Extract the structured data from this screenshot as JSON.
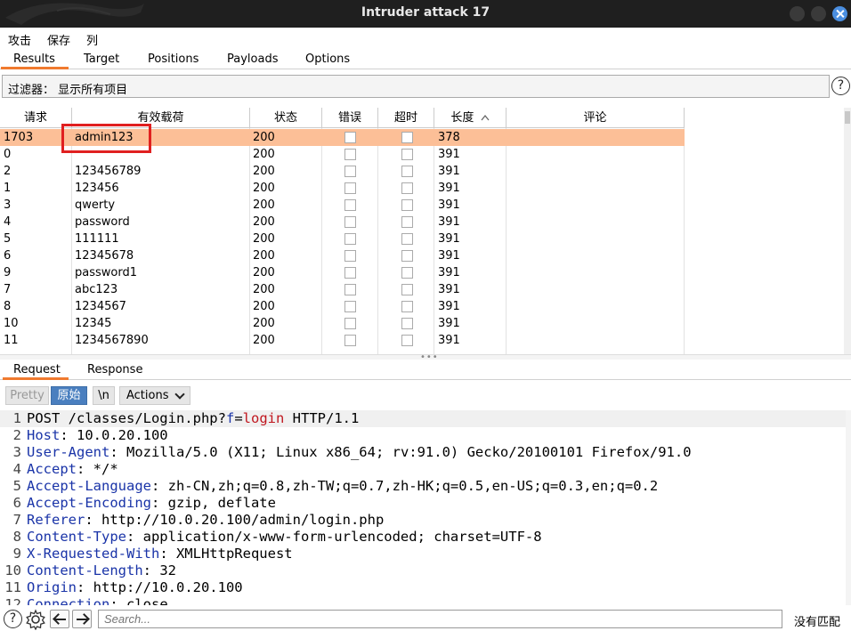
{
  "window": {
    "title": "Intruder attack 17"
  },
  "menu": [
    "攻击",
    "保存",
    "列"
  ],
  "tabs": [
    "Results",
    "Target",
    "Positions",
    "Payloads",
    "Options"
  ],
  "filter": {
    "label": "过滤器： 显示所有项目",
    "help": "?"
  },
  "table": {
    "columns": [
      "请求",
      "有效载荷",
      "状态",
      "错误",
      "超时",
      "长度",
      "评论"
    ],
    "sort_column": "长度",
    "sort_direction": "ascending",
    "rows": [
      {
        "request": "1703",
        "payload": "admin123",
        "status": "200",
        "error": false,
        "timeout": false,
        "length": "378",
        "comment": "",
        "selected": true
      },
      {
        "request": "0",
        "payload": "",
        "status": "200",
        "error": false,
        "timeout": false,
        "length": "391",
        "comment": ""
      },
      {
        "request": "2",
        "payload": "123456789",
        "status": "200",
        "error": false,
        "timeout": false,
        "length": "391",
        "comment": ""
      },
      {
        "request": "1",
        "payload": "123456",
        "status": "200",
        "error": false,
        "timeout": false,
        "length": "391",
        "comment": ""
      },
      {
        "request": "3",
        "payload": "qwerty",
        "status": "200",
        "error": false,
        "timeout": false,
        "length": "391",
        "comment": ""
      },
      {
        "request": "4",
        "payload": "password",
        "status": "200",
        "error": false,
        "timeout": false,
        "length": "391",
        "comment": ""
      },
      {
        "request": "5",
        "payload": "111111",
        "status": "200",
        "error": false,
        "timeout": false,
        "length": "391",
        "comment": ""
      },
      {
        "request": "6",
        "payload": "12345678",
        "status": "200",
        "error": false,
        "timeout": false,
        "length": "391",
        "comment": ""
      },
      {
        "request": "9",
        "payload": "password1",
        "status": "200",
        "error": false,
        "timeout": false,
        "length": "391",
        "comment": ""
      },
      {
        "request": "7",
        "payload": "abc123",
        "status": "200",
        "error": false,
        "timeout": false,
        "length": "391",
        "comment": ""
      },
      {
        "request": "8",
        "payload": "1234567",
        "status": "200",
        "error": false,
        "timeout": false,
        "length": "391",
        "comment": ""
      },
      {
        "request": "10",
        "payload": "12345",
        "status": "200",
        "error": false,
        "timeout": false,
        "length": "391",
        "comment": ""
      },
      {
        "request": "11",
        "payload": "1234567890",
        "status": "200",
        "error": false,
        "timeout": false,
        "length": "391",
        "comment": ""
      }
    ]
  },
  "subtabs": [
    "Request",
    "Response"
  ],
  "editor_toolbar": {
    "pretty": "Pretty",
    "raw": "原始",
    "newline": "\\n",
    "actions": "Actions"
  },
  "request_lines": [
    {
      "n": "1",
      "parts": [
        [
          "t",
          "POST /classes/Login.php?"
        ],
        [
          "k",
          "f"
        ],
        [
          "t",
          "="
        ],
        [
          "v",
          "login"
        ],
        [
          "t",
          " HTTP/1.1"
        ]
      ]
    },
    {
      "n": "2",
      "parts": [
        [
          "k",
          "Host"
        ],
        [
          "t",
          ": 10.0.20.100"
        ]
      ]
    },
    {
      "n": "3",
      "parts": [
        [
          "k",
          "User-Agent"
        ],
        [
          "t",
          ": Mozilla/5.0 (X11; Linux x86_64; rv:91.0) Gecko/20100101 Firefox/91.0"
        ]
      ]
    },
    {
      "n": "4",
      "parts": [
        [
          "k",
          "Accept"
        ],
        [
          "t",
          ": */*"
        ]
      ]
    },
    {
      "n": "5",
      "parts": [
        [
          "k",
          "Accept-Language"
        ],
        [
          "t",
          ": zh-CN,zh;q=0.8,zh-TW;q=0.7,zh-HK;q=0.5,en-US;q=0.3,en;q=0.2"
        ]
      ]
    },
    {
      "n": "6",
      "parts": [
        [
          "k",
          "Accept-Encoding"
        ],
        [
          "t",
          ": gzip, deflate"
        ]
      ]
    },
    {
      "n": "7",
      "parts": [
        [
          "k",
          "Referer"
        ],
        [
          "t",
          ": http://10.0.20.100/admin/login.php"
        ]
      ]
    },
    {
      "n": "8",
      "parts": [
        [
          "k",
          "Content-Type"
        ],
        [
          "t",
          ": application/x-www-form-urlencoded; charset=UTF-8"
        ]
      ]
    },
    {
      "n": "9",
      "parts": [
        [
          "k",
          "X-Requested-With"
        ],
        [
          "t",
          ": XMLHttpRequest"
        ]
      ]
    },
    {
      "n": "10",
      "parts": [
        [
          "k",
          "Content-Length"
        ],
        [
          "t",
          ": 32"
        ]
      ]
    },
    {
      "n": "11",
      "parts": [
        [
          "k",
          "Origin"
        ],
        [
          "t",
          ": http://10.0.20.100"
        ]
      ]
    },
    {
      "n": "12",
      "parts": [
        [
          "k",
          "Connection"
        ],
        [
          "t",
          ": close"
        ]
      ]
    }
  ],
  "bottom": {
    "search_placeholder": "Search...",
    "match_status": "没有匹配"
  },
  "colors": {
    "accent": "#f07a2f",
    "selected_row": "#fcbf97",
    "highlight_box": "#e02020",
    "header_key": "#1a34a8",
    "param_value": "#c0161e",
    "raw_button": "#4a7fbf"
  }
}
